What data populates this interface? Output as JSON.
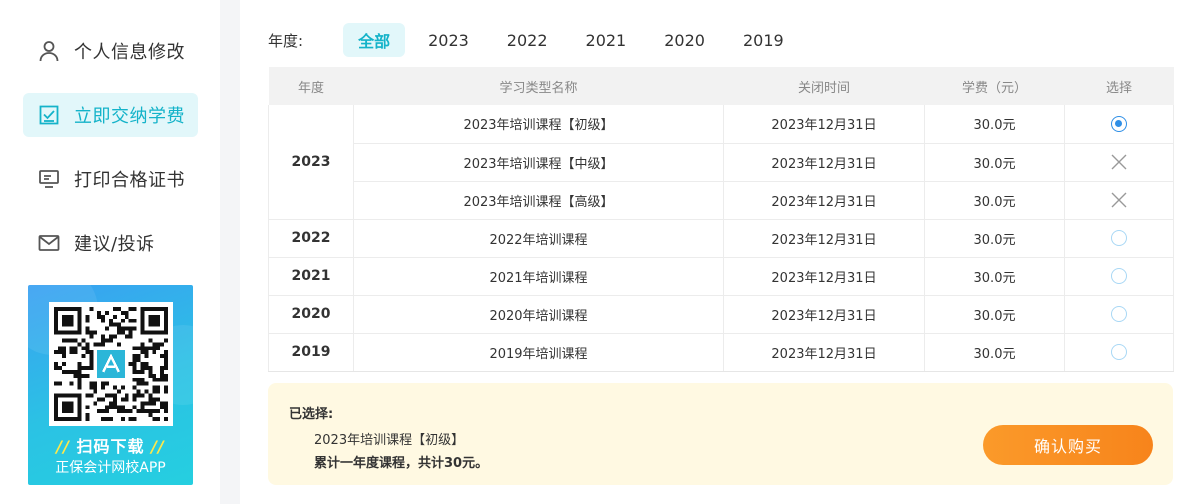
{
  "sidebar": {
    "items": [
      {
        "label": "个人信息修改",
        "icon": "user-icon"
      },
      {
        "label": "立即交纳学费",
        "icon": "checkbox-icon",
        "active": true
      },
      {
        "label": "打印合格证书",
        "icon": "monitor-icon"
      },
      {
        "label": "建议/投诉",
        "icon": "mail-icon"
      }
    ],
    "banner": {
      "title": "扫码下载",
      "subtitle": "正保会计网校APP",
      "slashes": "//"
    }
  },
  "filter": {
    "label": "年度:",
    "tabs": [
      "全部",
      "2023",
      "2022",
      "2021",
      "2020",
      "2019"
    ],
    "active": "全部"
  },
  "table": {
    "headers": [
      "年度",
      "学习类型名称",
      "关闭时间",
      "学费（元）",
      "选择"
    ],
    "groups": [
      {
        "year": "2023",
        "rows": [
          {
            "name": "2023年培训课程【初级】",
            "close": "2023年12月31日",
            "fee": "30.0元",
            "select": "checked"
          },
          {
            "name": "2023年培训课程【中级】",
            "close": "2023年12月31日",
            "fee": "30.0元",
            "select": "disabled"
          },
          {
            "name": "2023年培训课程【高级】",
            "close": "2023年12月31日",
            "fee": "30.0元",
            "select": "disabled"
          }
        ]
      },
      {
        "year": "2022",
        "rows": [
          {
            "name": "2022年培训课程",
            "close": "2023年12月31日",
            "fee": "30.0元",
            "select": "unchecked"
          }
        ]
      },
      {
        "year": "2021",
        "rows": [
          {
            "name": "2021年培训课程",
            "close": "2023年12月31日",
            "fee": "30.0元",
            "select": "unchecked"
          }
        ]
      },
      {
        "year": "2020",
        "rows": [
          {
            "name": "2020年培训课程",
            "close": "2023年12月31日",
            "fee": "30.0元",
            "select": "unchecked"
          }
        ]
      },
      {
        "year": "2019",
        "rows": [
          {
            "name": "2019年培训课程",
            "close": "2023年12月31日",
            "fee": "30.0元",
            "select": "unchecked"
          }
        ]
      }
    ]
  },
  "summary": {
    "title": "已选择:",
    "selected_item": "2023年培训课程【初级】",
    "total": "累计一年度课程，共计30元。",
    "buy_label": "确认购买"
  },
  "colors": {
    "accent": "#14b3c9",
    "radio_checked": "#2f8fe6",
    "buy_button": "#f7841b",
    "summary_bg": "#fff9e2"
  }
}
